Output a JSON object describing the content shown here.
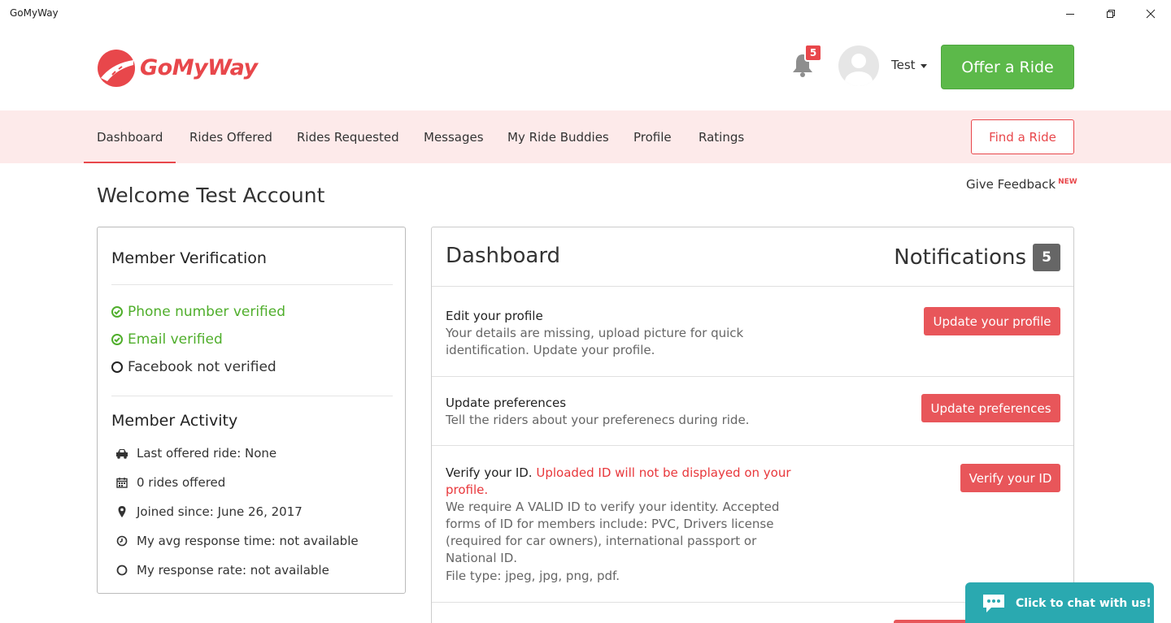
{
  "window": {
    "title": "GoMyWay"
  },
  "header": {
    "logo_text": "GoMyWay",
    "notification_badge": "5",
    "user_name": "Test",
    "offer_ride_label": "Offer a Ride"
  },
  "nav": {
    "items": [
      {
        "label": "Dashboard",
        "active": true
      },
      {
        "label": "Rides Offered"
      },
      {
        "label": "Rides Requested"
      },
      {
        "label": "Messages"
      },
      {
        "label": "My Ride Buddies"
      },
      {
        "label": "Profile"
      },
      {
        "label": "Ratings"
      }
    ],
    "find_ride_label": "Find a Ride"
  },
  "page": {
    "welcome": "Welcome Test Account",
    "feedback_label": "Give Feedback",
    "feedback_badge": "NEW"
  },
  "verification": {
    "heading": "Member Verification",
    "items": [
      {
        "label": "Phone number verified",
        "status": "verified"
      },
      {
        "label": "Email verified",
        "status": "verified"
      },
      {
        "label": "Facebook not verified",
        "status": "unverified"
      }
    ]
  },
  "activity": {
    "heading": "Member Activity",
    "items": [
      {
        "icon": "car-icon",
        "label": "Last offered ride: None"
      },
      {
        "icon": "calendar-icon",
        "label": "0 rides offered"
      },
      {
        "icon": "map-marker-icon",
        "label": "Joined since: June 26, 2017"
      },
      {
        "icon": "clock-icon",
        "label": "My avg response time: not available"
      },
      {
        "icon": "circle-icon",
        "label": "My response rate: not available"
      }
    ]
  },
  "dashboard": {
    "title": "Dashboard",
    "notifications_label": "Notifications",
    "notifications_count": "5",
    "tasks": [
      {
        "title": "Edit your profile",
        "warning": "",
        "description": "Your details are missing, upload picture for quick identification. Update your profile.",
        "button": "Update your profile"
      },
      {
        "title": "Update preferences",
        "warning": "",
        "description": "Tell the riders about your preferenecs during ride.",
        "button": "Update preferences"
      },
      {
        "title": "Verify your ID.",
        "warning": "Uploaded ID will not be displayed on your profile.",
        "description": "We require A VALID ID to verify your identity. Accepted forms of ID for members include: PVC, Drivers license (required for car owners), international passport or National ID.",
        "file_types": "File type: jpeg, jpg, png, pdf.",
        "button": "Verify your ID"
      }
    ]
  },
  "chat": {
    "label": "Click to chat with us!"
  },
  "colors": {
    "brand_red": "#e8474b",
    "offer_green": "#5cb94a",
    "verified_green": "#4fae2b",
    "nav_bg": "#fdeaea",
    "chat_teal": "#2aa9b0"
  }
}
